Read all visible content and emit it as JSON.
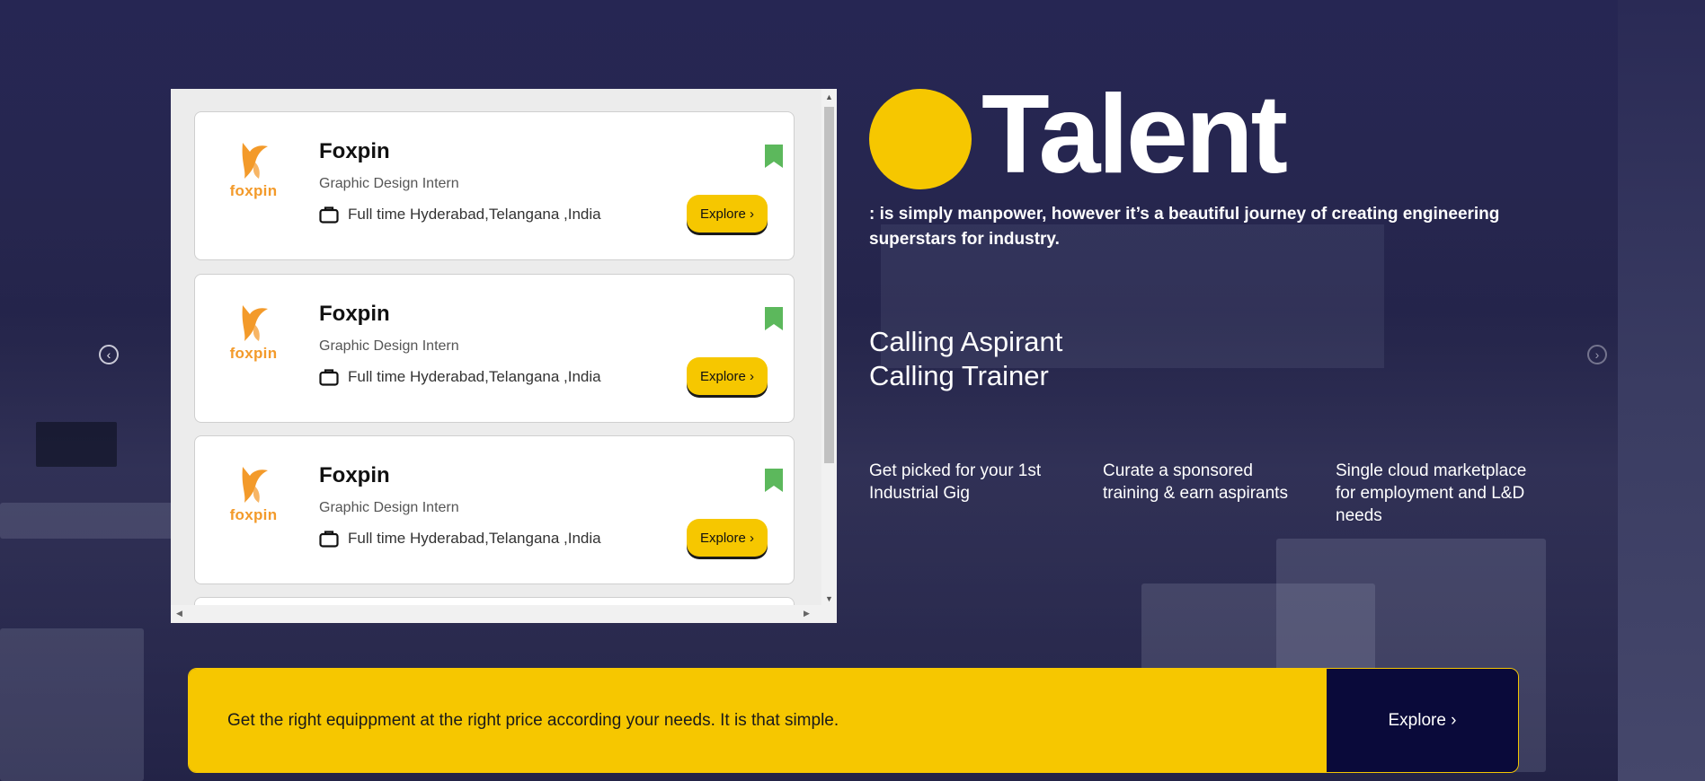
{
  "jobs": [
    {
      "company": "Foxpin",
      "logo_text": "foxpin",
      "role": "Graphic Design Intern",
      "meta": "Full time Hyderabad,Telangana ,India",
      "button": "Explore ›"
    },
    {
      "company": "Foxpin",
      "logo_text": "foxpin",
      "role": "Graphic Design Intern",
      "meta": "Full time Hyderabad,Telangana ,India",
      "button": "Explore ›"
    },
    {
      "company": "Foxpin",
      "logo_text": "foxpin",
      "role": "Graphic Design Intern",
      "meta": "Full time Hyderabad,Telangana ,India",
      "button": "Explore ›"
    }
  ],
  "hero": {
    "title": "Talent",
    "tagline": ": is simply manpower, however it’s a beautiful journey of creating engineering superstars for industry.",
    "calling_1": "Calling Aspirant",
    "calling_2": "Calling Trainer",
    "features": [
      "Get picked for your 1st Industrial Gig",
      "Curate a sponsored training & earn aspirants",
      "Single cloud marketplace for employment and L&D needs"
    ]
  },
  "banner": {
    "message": "Get the right equippment at the right price according your needs. It is that simple.",
    "cta": "Explore ›"
  },
  "carousel": {
    "prev": "‹",
    "next": "›"
  },
  "colors": {
    "accent": "#f6c700",
    "navy": "#0a0a3a",
    "bookmark": "#5cb85c",
    "logo_orange": "#f39a2a"
  },
  "icons": [
    "fox-logo-icon",
    "briefcase-icon",
    "bookmark-icon",
    "chevron-left-icon",
    "chevron-right-icon"
  ]
}
